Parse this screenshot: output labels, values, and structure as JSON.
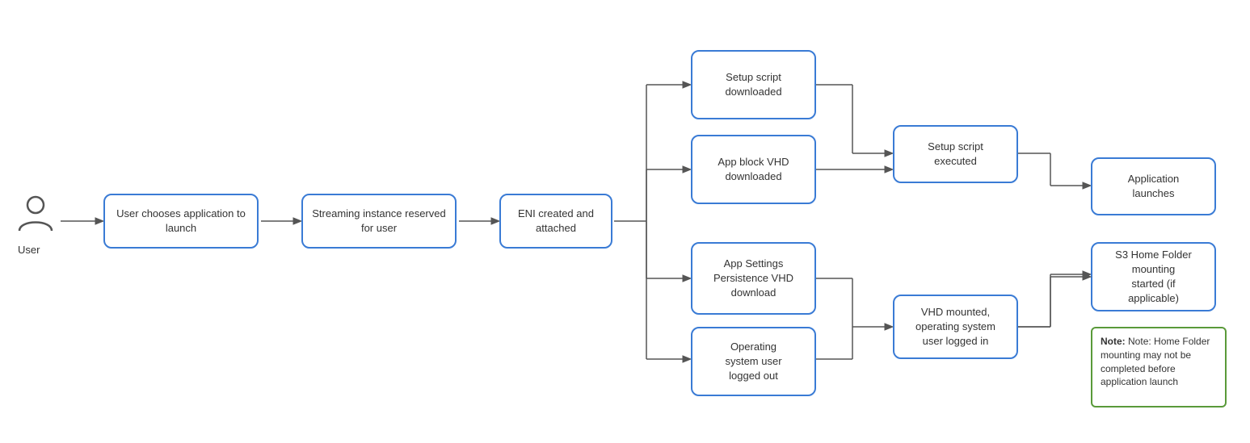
{
  "nodes": {
    "user_label": "User",
    "choose_app": "User chooses application to\nlaunch",
    "streaming_instance": "Streaming instance reserved for user",
    "eni": "ENI created and\nattached",
    "setup_script_dl": "Setup script\ndownloaded",
    "app_block_vhd": "App block VHD\ndownloaded",
    "app_settings": "App Settings\nPersistence VHD\ndownload",
    "os_user": "Operating\nsystem user\nlogged out",
    "setup_script_exec": "Setup script\nexecuted",
    "vhd_mounted": "VHD mounted,\noperating system\nuser logged in",
    "app_launches": "Application\nlaunches",
    "s3_home": "S3 Home Folder\nmounting\nstarted (if\napplicable)",
    "note": "Note: Home Folder\nmounting may not be\ncompleted before\napplication launch"
  }
}
